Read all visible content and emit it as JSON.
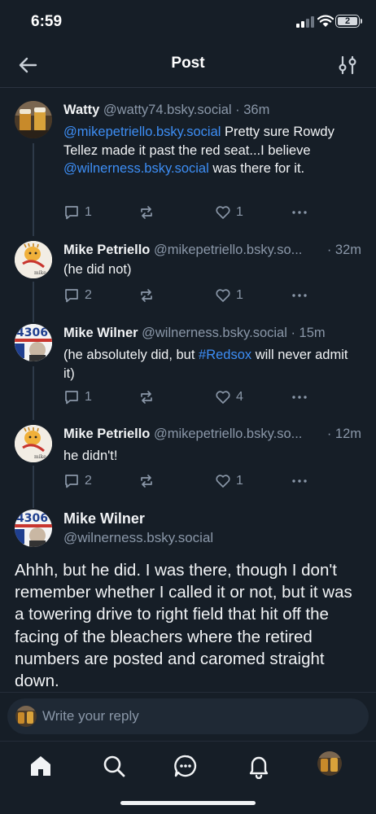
{
  "status_bar": {
    "time": "6:59",
    "battery": "2"
  },
  "header": {
    "title": "Post"
  },
  "colors": {
    "background": "#161e27",
    "link": "#3d8ef5",
    "muted": "#8a97a8",
    "text": "#f1f3f5"
  },
  "replies": [
    {
      "name": "Watty",
      "handle": "@watty74.bsky.social · 36m",
      "text_segments": [
        {
          "type": "link",
          "text": "@mikepetriello.bsky.social"
        },
        {
          "type": "text",
          "text": " Pretty sure Rowdy Tellez made it past the red seat...I believe "
        },
        {
          "type": "link",
          "text": "@wilnerness.bsky.social"
        },
        {
          "type": "text",
          "text": " was there for it."
        }
      ],
      "replies_count": "1",
      "likes_count": "1"
    },
    {
      "name": "Mike Petriello",
      "handle": "@mikepetriello.bsky.so...",
      "time": "· 32m",
      "text_segments": [
        {
          "type": "text",
          "text": "(he did not)"
        }
      ],
      "replies_count": "2",
      "likes_count": "1"
    },
    {
      "name": "Mike Wilner",
      "handle": "@wilnerness.bsky.social · 15m",
      "text_segments": [
        {
          "type": "text",
          "text": "(he absolutely did, but "
        },
        {
          "type": "link",
          "text": "#Redsox"
        },
        {
          "type": "text",
          "text": " will never admit it)"
        }
      ],
      "replies_count": "1",
      "likes_count": "4"
    },
    {
      "name": "Mike Petriello",
      "handle": "@mikepetriello.bsky.so...",
      "time": "· 12m",
      "text_segments": [
        {
          "type": "text",
          "text": "he didn't!"
        }
      ],
      "replies_count": "2",
      "likes_count": "1"
    }
  ],
  "main_post": {
    "name": "Mike Wilner",
    "handle": "@wilnerness.bsky.social",
    "avatar_text": "4306",
    "text": "Ahhh, but he did. I was there, though I don't remember whether I called it or not, but it was a towering drive to right field that hit off the facing of the bleachers where the retired numbers are posted and caromed straight down."
  },
  "reply_box": {
    "placeholder": "Write your reply"
  },
  "icons": {
    "back": "arrow-left-icon",
    "settings": "sliders-icon",
    "reply": "speech-bubble-icon",
    "repost": "repost-icon",
    "like": "heart-icon",
    "more": "ellipsis-icon",
    "tabs": [
      "home-icon",
      "search-icon",
      "chat-icon",
      "bell-icon",
      "profile-avatar"
    ]
  }
}
